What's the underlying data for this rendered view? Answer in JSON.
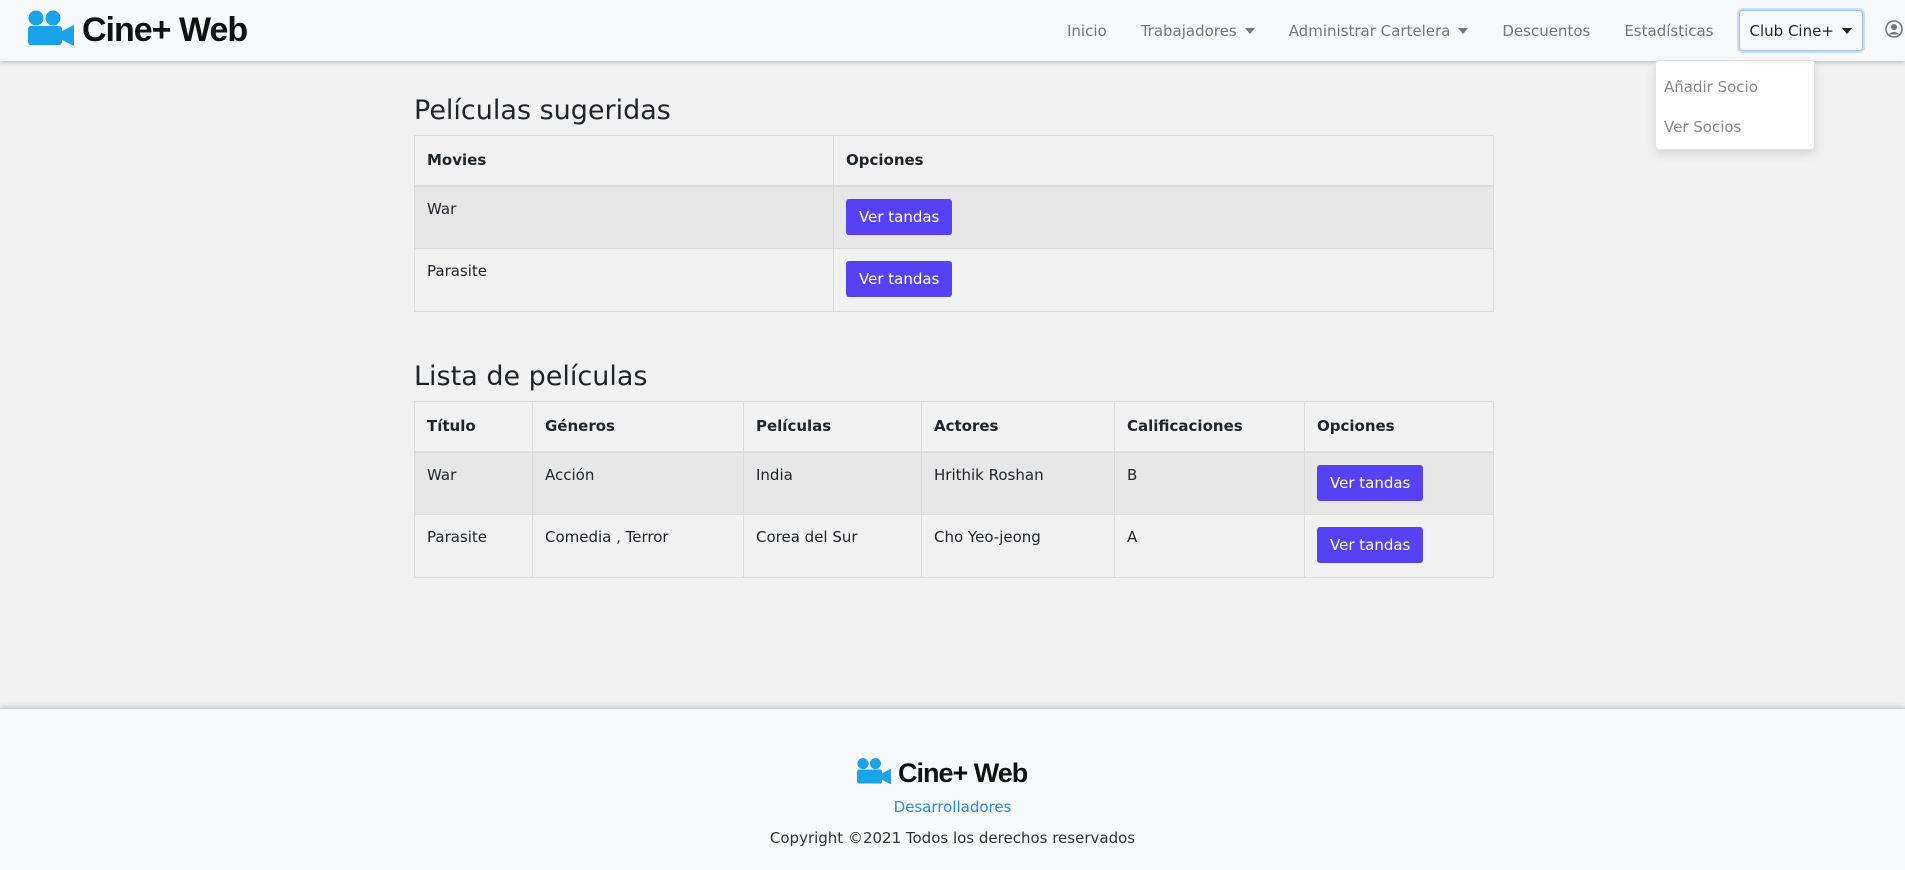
{
  "brand": {
    "name": "Cine+ Web",
    "icon": "camera-icon",
    "color": "#1aa3e8"
  },
  "nav": {
    "inicio": "Inicio",
    "trabajadores": "Trabajadores",
    "cartelera": "Administrar Cartelera",
    "descuentos": "Descuentos",
    "estadisticas": "Estadísticas",
    "club": "Club Cine+",
    "user_icon": "user-circle-icon"
  },
  "club_dropdown": {
    "items": [
      "Añadir Socio",
      "Ver Socios"
    ]
  },
  "suggested": {
    "title": "Películas sugeridas",
    "headers": [
      "Movies",
      "Opciones"
    ],
    "rows": [
      {
        "movie": "War",
        "button": "Ver tandas"
      },
      {
        "movie": "Parasite",
        "button": "Ver tandas"
      }
    ]
  },
  "list": {
    "title": "Lista de películas",
    "headers": [
      "Título",
      "Géneros",
      "Películas",
      "Actores",
      "Calificaciones",
      "Opciones"
    ],
    "rows": [
      {
        "titulo": "War",
        "generos": "Acción",
        "peliculas": "India",
        "actores": "Hrithik Roshan",
        "calificacion": "B",
        "button": "Ver tandas"
      },
      {
        "titulo": "Parasite",
        "generos": "Comedia , Terror",
        "peliculas": "Corea del Sur",
        "actores": "Cho Yeo-jeong",
        "calificacion": "A",
        "button": "Ver tandas"
      }
    ]
  },
  "footer": {
    "brand": "Cine+ Web",
    "link": "Desarrolladores",
    "copyright": "Copyright ©2021 Todos los derechos reservados"
  },
  "colors": {
    "button": "#5542f5",
    "link": "#2a8de0",
    "accent": "#1aa3e8"
  }
}
